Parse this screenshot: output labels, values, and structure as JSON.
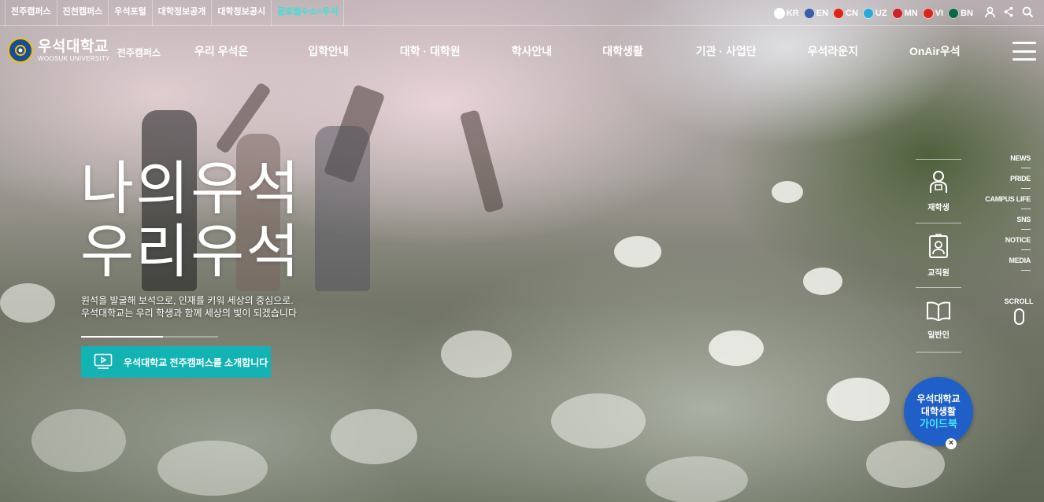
{
  "quick_links": [
    {
      "label": "전주캠퍼스",
      "highlight": false
    },
    {
      "label": "진천캠퍼스",
      "highlight": false
    },
    {
      "label": "우석포털",
      "highlight": false
    },
    {
      "label": "대학정보공개",
      "highlight": false
    },
    {
      "label": "대학정보공시",
      "highlight": false
    },
    {
      "label": "글로벌수소=우석",
      "highlight": true
    }
  ],
  "languages": [
    {
      "code": "KR",
      "flag_color": "#ffffff"
    },
    {
      "code": "EN",
      "flag_color": "#3c5ca8"
    },
    {
      "code": "CN",
      "flag_color": "#d8261b"
    },
    {
      "code": "UZ",
      "flag_color": "#2aa8d8"
    },
    {
      "code": "MN",
      "flag_color": "#c8242b"
    },
    {
      "code": "VI",
      "flag_color": "#da251d"
    },
    {
      "code": "BN",
      "flag_color": "#0a6a40"
    }
  ],
  "utility_icons": [
    "user-icon",
    "share-icon",
    "search-icon"
  ],
  "logo": {
    "name_ko": "우석대학교",
    "name_en": "WOOSUK UNIVERSITY",
    "campus": "전주캠퍼스"
  },
  "main_menu": [
    "우리 우석은",
    "입학안내",
    "대학 · 대학원",
    "학사안내",
    "대학생활",
    "기관 · 사업단",
    "우석라운지",
    "OnAir우석"
  ],
  "hero": {
    "title_line1": "나의우석",
    "title_line2": "우리우석",
    "subtitle_line1": "원석을 발굴해 보석으로, 인재를 키워 세상의 중심으로.",
    "subtitle_line2": "우석대학교는 우리 학생과 함께 세상의 빛이 되겠습니다",
    "slide_progress": 0.6,
    "intro_button": "우석대학교 전주캠퍼스를 소개합니다"
  },
  "user_nav": [
    {
      "label": "재학생",
      "icon": "student-icon"
    },
    {
      "label": "교직원",
      "icon": "staff-id-icon"
    },
    {
      "label": "일반인",
      "icon": "book-icon"
    }
  ],
  "section_nav": [
    "NEWS",
    "PRIDE",
    "CAMPUS LIFE",
    "SNS",
    "NOTICE",
    "MEDIA"
  ],
  "scroll_label": "SCROLL",
  "guide_badge": {
    "line1": "우석대학교",
    "line2": "대학생활",
    "line3": "가이드북"
  },
  "colors": {
    "accent_teal": "#14b3b3",
    "highlight_link": "#3ee0d6",
    "badge_blue": "#1f5fc7"
  }
}
